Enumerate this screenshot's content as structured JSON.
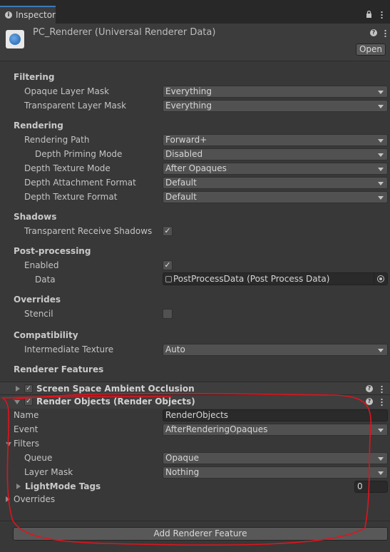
{
  "tab": {
    "label": "Inspector"
  },
  "header": {
    "title": "PC_Renderer (Universal Renderer Data)",
    "open_label": "Open"
  },
  "filtering": {
    "title": "Filtering",
    "opaque_label": "Opaque Layer Mask",
    "opaque_value": "Everything",
    "transparent_label": "Transparent Layer Mask",
    "transparent_value": "Everything"
  },
  "rendering": {
    "title": "Rendering",
    "path_label": "Rendering Path",
    "path_value": "Forward+",
    "depth_priming_label": "Depth Priming Mode",
    "depth_priming_value": "Disabled",
    "depth_tex_mode_label": "Depth Texture Mode",
    "depth_tex_mode_value": "After Opaques",
    "depth_attach_label": "Depth Attachment Format",
    "depth_attach_value": "Default",
    "depth_tex_format_label": "Depth Texture Format",
    "depth_tex_format_value": "Default"
  },
  "shadows": {
    "title": "Shadows",
    "transparent_receive_label": "Transparent Receive Shadows",
    "transparent_receive_checked": true
  },
  "post": {
    "title": "Post-processing",
    "enabled_label": "Enabled",
    "enabled_checked": true,
    "data_label": "Data",
    "data_value": "PostProcessData (Post Process Data)"
  },
  "overrides": {
    "title": "Overrides",
    "stencil_label": "Stencil",
    "stencil_checked": false
  },
  "compat": {
    "title": "Compatibility",
    "intermediate_label": "Intermediate Texture",
    "intermediate_value": "Auto"
  },
  "features": {
    "title": "Renderer Features",
    "ssao_label": "Screen Space Ambient Occlusion",
    "ro_label": "Render Objects (Render Objects)",
    "name_label": "Name",
    "name_value": "RenderObjects",
    "event_label": "Event",
    "event_value": "AfterRenderingOpaques",
    "filters_label": "Filters",
    "queue_label": "Queue",
    "queue_value": "Opaque",
    "layer_mask_label": "Layer Mask",
    "layer_mask_value": "Nothing",
    "lightmode_label": "LightMode Tags",
    "lightmode_value": "0",
    "overrides_label": "Overrides"
  },
  "add_button": "Add Renderer Feature",
  "check_glyph": "✓",
  "help_glyph": "?",
  "colors": {
    "annotation_red": "#e0141e",
    "accent_blue": "#3a79bb"
  }
}
